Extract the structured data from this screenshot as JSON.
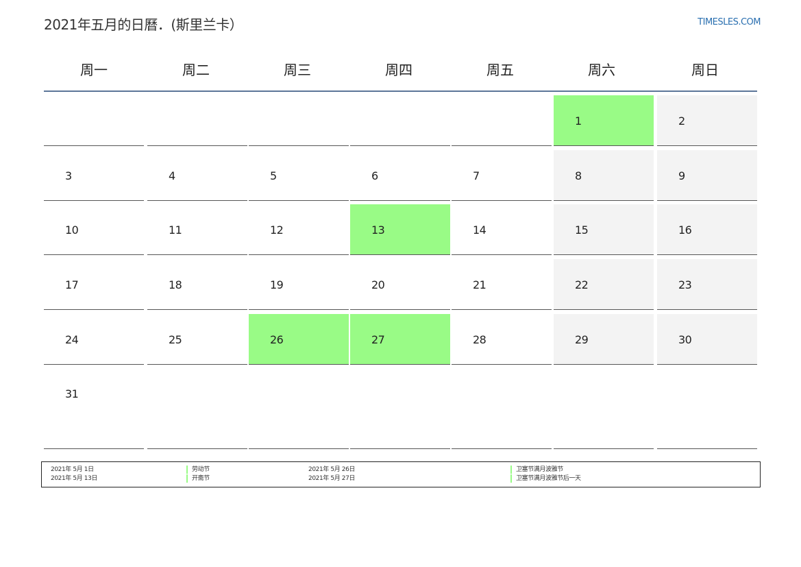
{
  "title": "2021年五月的日曆．(斯里兰卡）",
  "brand": "TIMESLES.COM",
  "colors": {
    "holiday": "#99fb86",
    "weekend": "#f3f3f3",
    "header_rule": "#5b7598",
    "brand": "#2a6fb0"
  },
  "weekdays": [
    "周一",
    "周二",
    "周三",
    "周四",
    "周五",
    "周六",
    "周日"
  ],
  "weeks": [
    [
      "",
      "",
      "",
      "",
      "",
      "1",
      "2"
    ],
    [
      "3",
      "4",
      "5",
      "6",
      "7",
      "8",
      "9"
    ],
    [
      "10",
      "11",
      "12",
      "13",
      "14",
      "15",
      "16"
    ],
    [
      "17",
      "18",
      "19",
      "20",
      "21",
      "22",
      "23"
    ],
    [
      "24",
      "25",
      "26",
      "27",
      "28",
      "29",
      "30"
    ],
    [
      "31",
      "",
      "",
      "",
      "",
      "",
      ""
    ]
  ],
  "holiday_days": [
    "1",
    "13",
    "26",
    "27"
  ],
  "legend": [
    {
      "date": "2021年 5月 1日",
      "name": "劳动节"
    },
    {
      "date": "2021年 5月 13日",
      "name": "开斋节"
    },
    {
      "date": "2021年 5月 26日",
      "name": "卫塞节满月波雅节"
    },
    {
      "date": "2021年 5月 27日",
      "name": "卫塞节满月波雅节后一天"
    }
  ]
}
